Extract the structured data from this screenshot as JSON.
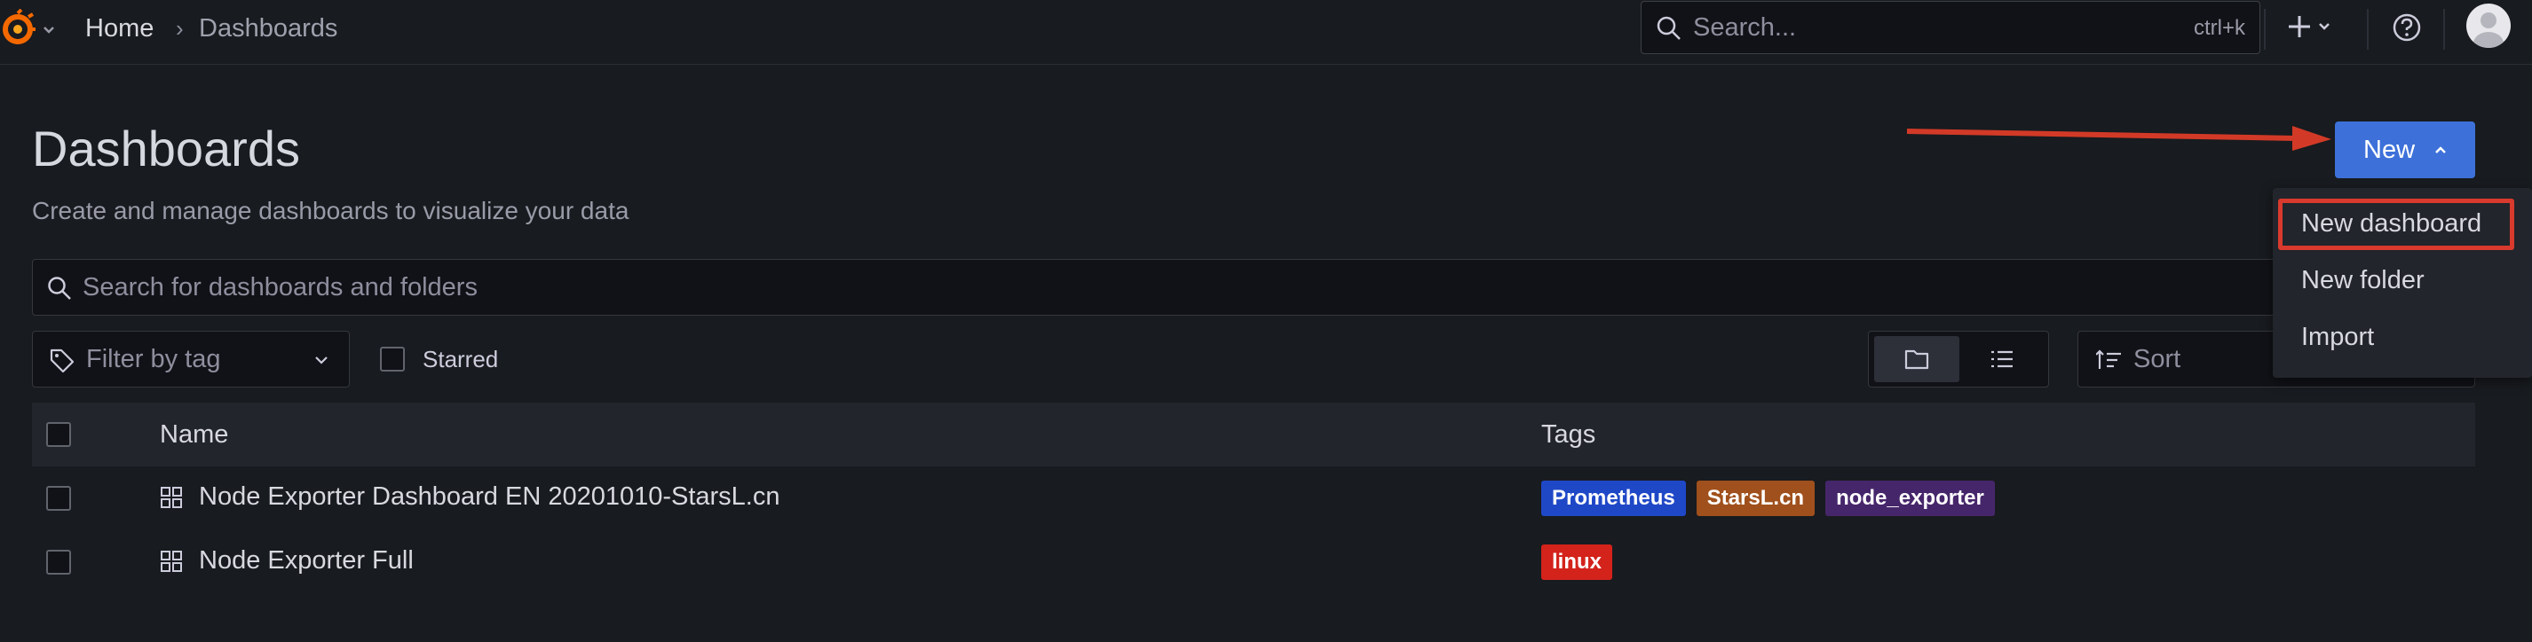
{
  "topbar": {
    "breadcrumb": [
      "Home",
      "Dashboards"
    ],
    "breadcrumb_separator": "›",
    "search_placeholder": "Search...",
    "search_shortcut": "ctrl+k",
    "add_icon": "plus-icon",
    "help_icon": "help-icon"
  },
  "page": {
    "title": "Dashboards",
    "subtitle": "Create and manage dashboards to visualize your data",
    "new_button": "New",
    "accent_color": "#3d71d9"
  },
  "search": {
    "placeholder": "Search for dashboards and folders"
  },
  "filters": {
    "tag_placeholder": "Filter by tag",
    "starred_label": "Starred",
    "sort_placeholder": "Sort"
  },
  "table": {
    "columns": [
      "Name",
      "Tags"
    ],
    "rows": [
      {
        "name": "Node Exporter Dashboard EN 20201010-StarsL.cn",
        "tags": [
          {
            "label": "Prometheus",
            "color": "#1f48c7"
          },
          {
            "label": "StarsL.cn",
            "color": "#a0501c"
          },
          {
            "label": "node_exporter",
            "color": "#46266b"
          }
        ]
      },
      {
        "name": "Node Exporter Full",
        "tags": [
          {
            "label": "linux",
            "color": "#d3231b"
          }
        ]
      }
    ]
  },
  "new_menu": {
    "items": [
      "New dashboard",
      "New folder",
      "Import"
    ],
    "highlight_color": "#d93a2e"
  }
}
